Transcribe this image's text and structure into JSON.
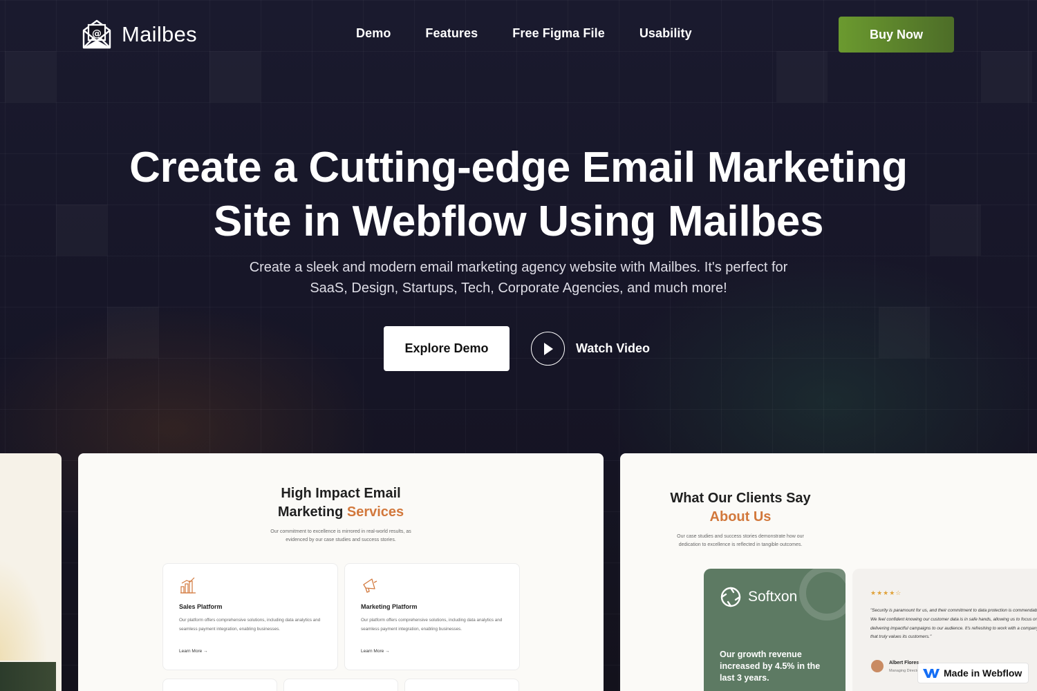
{
  "header": {
    "brand": "Mailbes",
    "nav": [
      "Demo",
      "Features",
      "Free Figma File",
      "Usability"
    ],
    "buy_label": "Buy Now"
  },
  "hero": {
    "title_line1": "Create a Cutting-edge Email Marketing",
    "title_line2": "Site in Webflow Using Mailbes",
    "subtitle_line1": "Create a sleek and modern email marketing agency website with Mailbes. It's perfect for",
    "subtitle_line2": "SaaS, Design, Startups, Tech, Corporate Agencies, and much more!",
    "explore_label": "Explore Demo",
    "watch_label": "Watch Video"
  },
  "services_preview": {
    "title_line1": "High Impact Email",
    "title_line2_plain": "Marketing ",
    "title_line2_accent": "Services",
    "desc_line1": "Our commitment to excellence is mirrored in real-world results, as",
    "desc_line2": "evidenced by our case studies and success stories.",
    "cards": [
      {
        "title": "Sales Platform",
        "desc": "Our platform offers comprehensive solutions, including data analytics and seamless payment integration, enabling businesses.",
        "link": "Learn More →",
        "icon": "bar-chart-icon"
      },
      {
        "title": "Marketing Platform",
        "desc": "Our platform offers comprehensive solutions, including data analytics and seamless payment integration, enabling businesses.",
        "link": "Learn More →",
        "icon": "megaphone-icon"
      }
    ]
  },
  "testimonials_preview": {
    "title_line1": "What Our Clients Say",
    "title_line2": "About Us",
    "desc_line1": "Our case studies and success stories demonstrate how our",
    "desc_line2": "dedication to excellence is reflected in tangible outcomes.",
    "company": "Softxon",
    "stat": "Our growth revenue increased by 4.5% in the last 3 years.",
    "stars": "★★★★☆",
    "quote": "\"Security is paramount for us, and their commitment to data protection is commendable. We feel confident knowing our customer data is in safe hands, allowing us to focus on delivering impactful campaigns to our audience. It's refreshing to work with a company that truly values its customers.\"",
    "reviewer_name": "Albert Flores",
    "reviewer_role": "Managing Director"
  },
  "badge": {
    "label": "Made in Webflow"
  },
  "colors": {
    "accent": "#d2783c",
    "buy_button": "#5f8a2c",
    "background": "#16152a",
    "softxon_card": "#5d7a63"
  }
}
